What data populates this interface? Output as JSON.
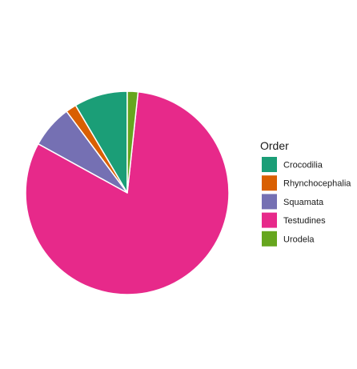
{
  "chart_data": {
    "type": "pie",
    "title": "",
    "legend": {
      "title": "Order",
      "position": "right"
    },
    "slices": [
      {
        "label": "Crocodilia",
        "value": 8.5,
        "color": "#1B9E77"
      },
      {
        "label": "Rhynchocephalia",
        "value": 1.7,
        "color": "#D95F02"
      },
      {
        "label": "Squamata",
        "value": 6.8,
        "color": "#7570B3"
      },
      {
        "label": "Testudines",
        "value": 81.3,
        "color": "#E7298A"
      },
      {
        "label": "Urodela",
        "value": 1.7,
        "color": "#66A61E"
      }
    ],
    "start_angle_deg": 0,
    "direction": "counterclockwise",
    "slice_border_color": "#ffffff"
  }
}
